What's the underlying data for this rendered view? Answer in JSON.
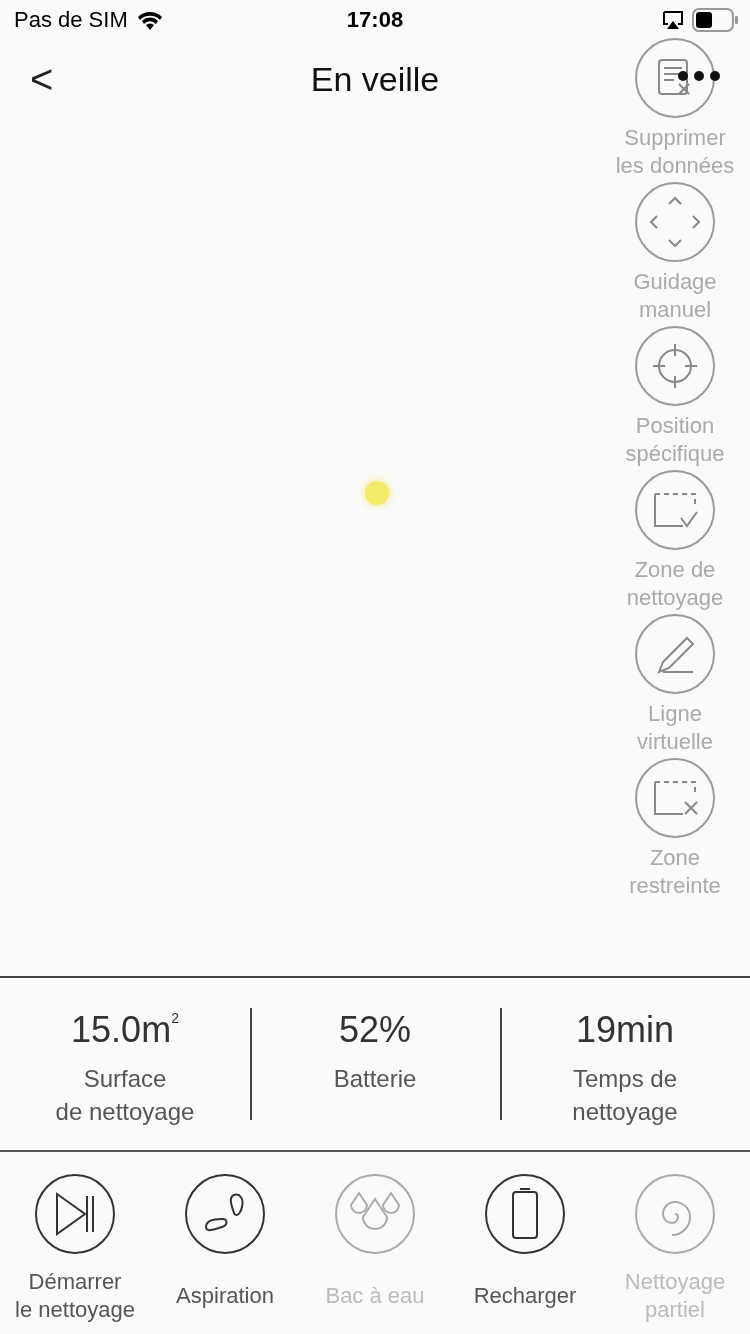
{
  "status_bar": {
    "carrier": "Pas de SIM",
    "time": "17:08"
  },
  "nav": {
    "back": "<",
    "title": "En veille"
  },
  "tools": [
    {
      "kind": "delete-data",
      "label": "Supprimer\nles données"
    },
    {
      "kind": "manual",
      "label": "Guidage\nmanuel"
    },
    {
      "kind": "target",
      "label": "Position\nspécifique"
    },
    {
      "kind": "zone-clean",
      "label": "Zone de\nnettoyage"
    },
    {
      "kind": "line",
      "label": "Ligne\nvirtuelle"
    },
    {
      "kind": "zone-forbid",
      "label": "Zone\nrestreinte"
    }
  ],
  "stats": [
    {
      "value": "15.0m$^{2}$",
      "label": "Surface\nde nettoyage"
    },
    {
      "value": "52%",
      "label": "Batterie"
    },
    {
      "value": "19min",
      "label": "Temps de\nnettoyage"
    }
  ],
  "actions": [
    {
      "kind": "start",
      "label": "Démarrer\nle nettoyage",
      "disabled": false
    },
    {
      "kind": "suction",
      "label": "Aspiration",
      "disabled": false
    },
    {
      "kind": "water",
      "label": "Bac à eau",
      "disabled": true
    },
    {
      "kind": "recharge",
      "label": "Recharger",
      "disabled": false
    },
    {
      "kind": "spiral",
      "label": "Nettoyage\npartiel",
      "disabled": true
    }
  ]
}
